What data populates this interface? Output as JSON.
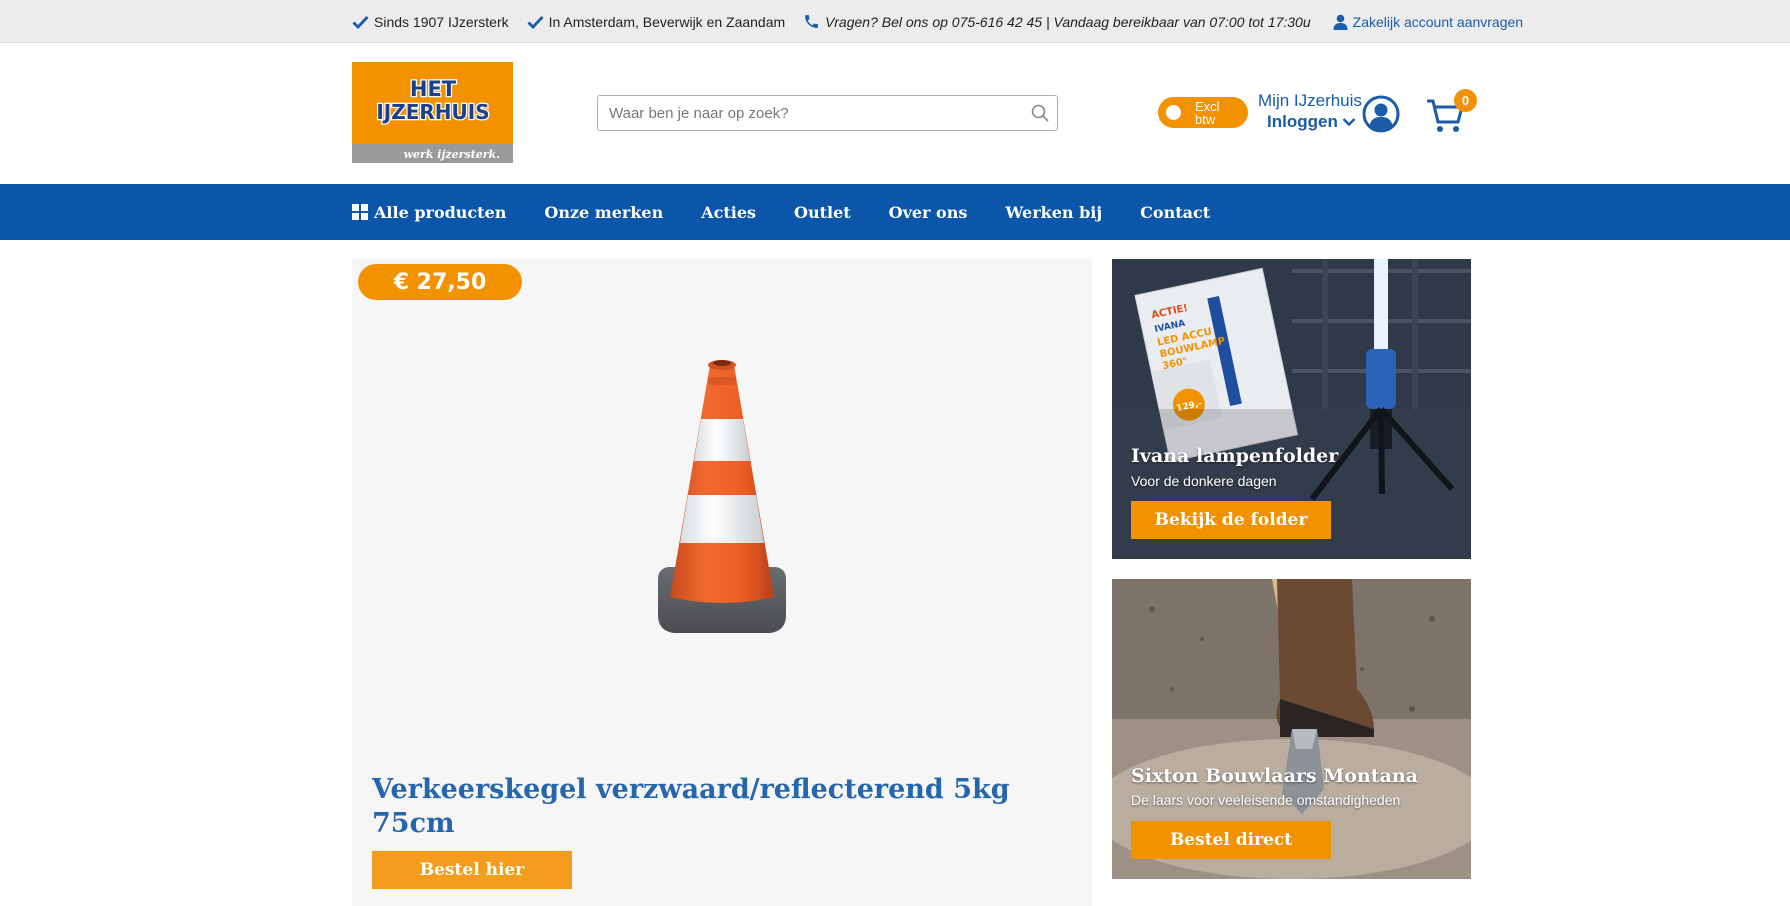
{
  "topbar": {
    "usps": [
      {
        "text": "Sinds 1907 IJzersterk",
        "icon": "check-icon"
      },
      {
        "text": "In Amsterdam, Beverwijk en Zaandam",
        "icon": "check-icon"
      },
      {
        "text": "Vragen? Bel ons op 075-616 42 45 | Vandaag bereikbaar van 07:00 tot 17:30u",
        "icon": "phone-icon"
      }
    ],
    "business_link": {
      "text": "Zakelijk account aanvragen",
      "icon": "user-icon"
    }
  },
  "header": {
    "logo": {
      "line1": "HET",
      "line2": "IJZERHUIS",
      "tagline": "werk ijzersterk."
    },
    "search": {
      "placeholder": "Waar ben je naar op zoek?",
      "value": ""
    },
    "vat_toggle": {
      "label_line1": "Excl",
      "label_line2": "btw"
    },
    "account": {
      "title": "Mijn IJzerhuis",
      "action": "Inloggen"
    },
    "cart": {
      "count": "0"
    }
  },
  "nav": {
    "items": [
      {
        "label": "Alle producten",
        "icon": "grid-icon"
      },
      {
        "label": "Onze merken"
      },
      {
        "label": "Acties"
      },
      {
        "label": "Outlet"
      },
      {
        "label": "Over ons"
      },
      {
        "label": "Werken bij"
      },
      {
        "label": "Contact"
      }
    ]
  },
  "hero": {
    "price": "€ 27,50",
    "title": "Verkeerskegel verzwaard/reflecterend 5kg 75cm",
    "button": "Bestel hier"
  },
  "promos": [
    {
      "title": "Ivana lampenfolder",
      "subtitle": "Voor de donkere dagen",
      "button": "Bekijk de folder",
      "folder": {
        "badge": "ACTIE!",
        "brand": "IVANA",
        "line1": "LED ACCU",
        "line2": "BOUWLAMP",
        "line3": "360°",
        "price": "129,-"
      }
    },
    {
      "title": "Sixton Bouwlaars Montana",
      "subtitle": "De laars voor veeleisende omstandigheden",
      "button": "Bestel direct"
    }
  ],
  "colors": {
    "brand_blue": "#0b56a8",
    "brand_orange": "#f39200",
    "link_blue": "#1b5ca8"
  }
}
